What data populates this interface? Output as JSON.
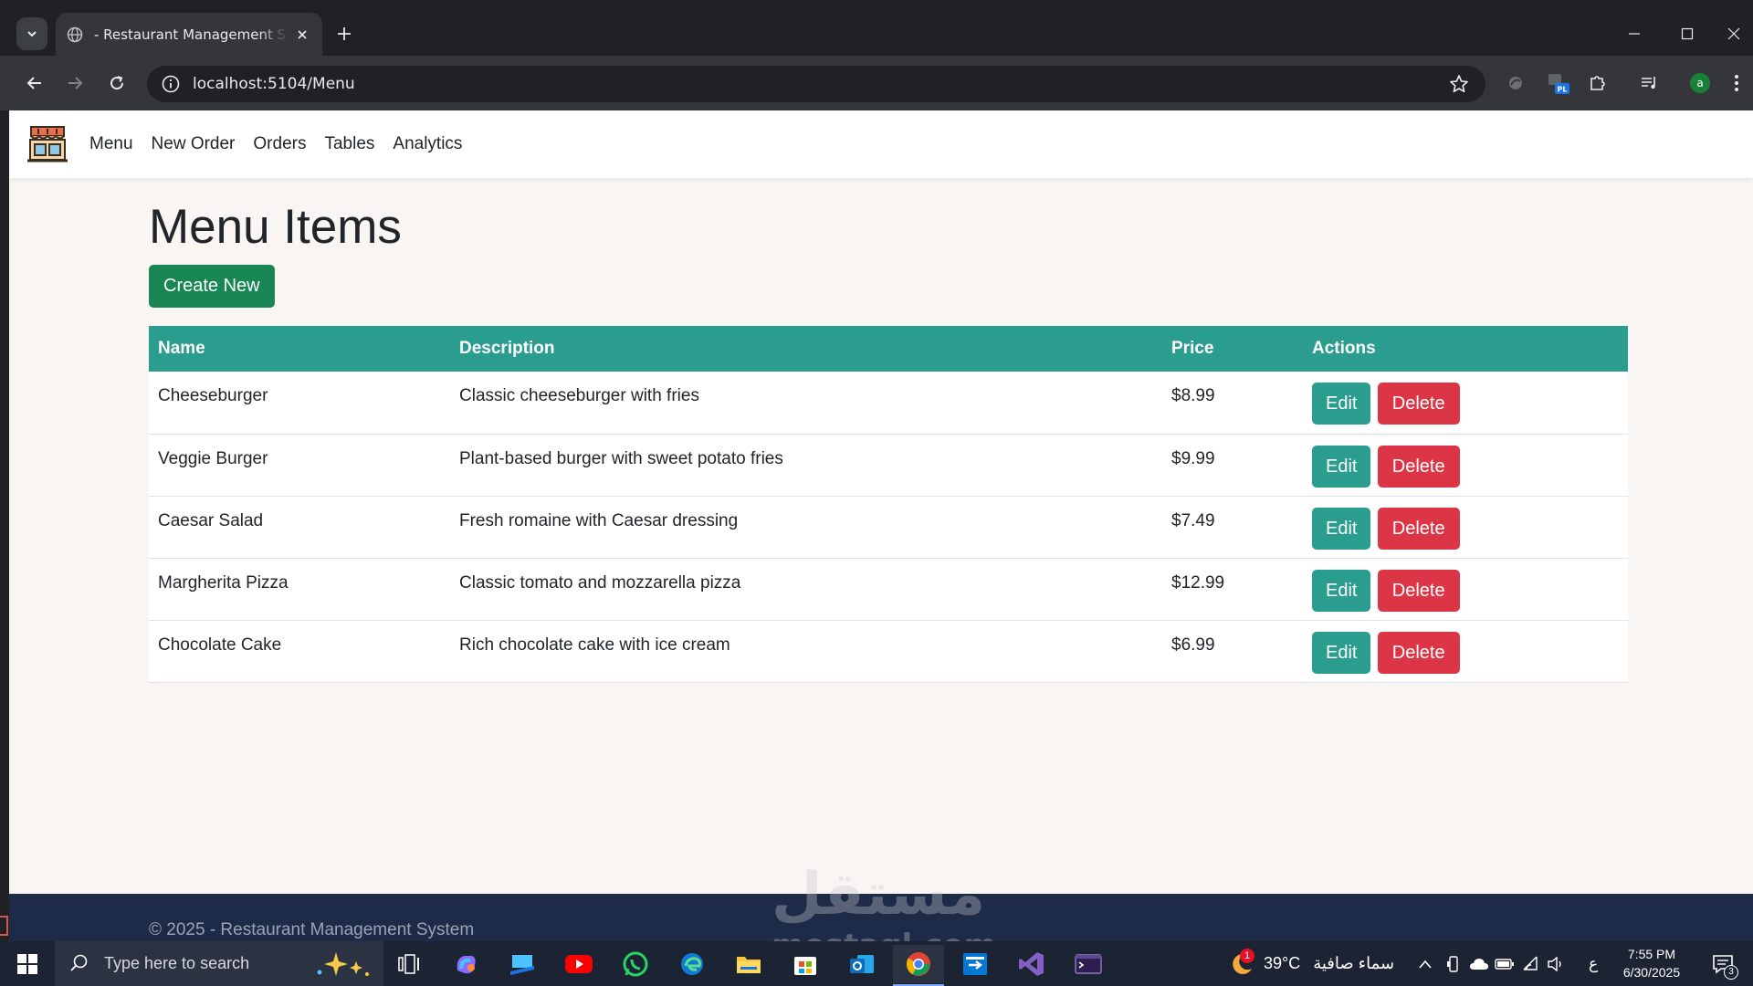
{
  "browser": {
    "tab_title": "- Restaurant Management System",
    "url": "localhost:5104/Menu"
  },
  "app": {
    "nav": [
      "Menu",
      "New Order",
      "Orders",
      "Tables",
      "Analytics"
    ],
    "page_title": "Menu Items",
    "create_label": "Create New",
    "table": {
      "headers": [
        "Name",
        "Description",
        "Price",
        "Actions"
      ],
      "rows": [
        {
          "name": "Cheeseburger",
          "description": "Classic cheeseburger with fries",
          "price": "$8.99"
        },
        {
          "name": "Veggie Burger",
          "description": "Plant-based burger with sweet potato fries",
          "price": "$9.99"
        },
        {
          "name": "Caesar Salad",
          "description": "Fresh romaine with Caesar dressing",
          "price": "$7.49"
        },
        {
          "name": "Margherita Pizza",
          "description": "Classic tomato and mozzarella pizza",
          "price": "$12.99"
        },
        {
          "name": "Chocolate Cake",
          "description": "Rich chocolate cake with ice cream",
          "price": "$6.99"
        }
      ],
      "edit_label": "Edit",
      "delete_label": "Delete"
    },
    "footer_text": "© 2025 - Restaurant Management System"
  },
  "watermark": {
    "arabic": "مستقل",
    "latin": "mostaql.com"
  },
  "taskbar": {
    "search_placeholder": "Type here to search",
    "weather_temp": "39°C",
    "weather_text": "سماء صافية",
    "weather_badge": "1",
    "lang": "ع",
    "time": "7:55 PM",
    "date": "6/30/2025",
    "notifications": "3"
  },
  "colors": {
    "primary": "#2a9d8f",
    "create": "#198754",
    "delete": "#dc3545",
    "footer": "#1d2b49",
    "page_bg": "#f8f5f2"
  }
}
